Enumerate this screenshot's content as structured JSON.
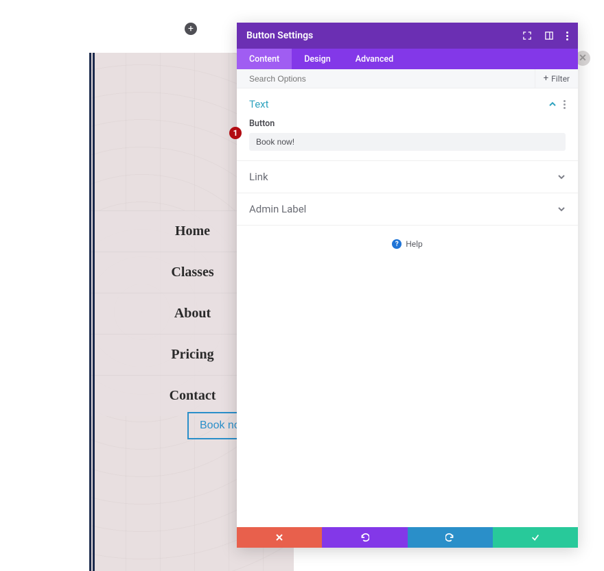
{
  "preview": {
    "nav_items": [
      "Home",
      "Classes",
      "About",
      "Pricing",
      "Contact"
    ],
    "button_label": "Book now!",
    "add_label": "+",
    "close_label": "✕"
  },
  "panel": {
    "title": "Button Settings",
    "tabs": {
      "content": "Content",
      "design": "Design",
      "advanced": "Advanced"
    },
    "search_placeholder": "Search Options",
    "filter_label": "Filter",
    "sections": {
      "text": {
        "title": "Text",
        "field_label": "Button",
        "field_value": "Book now!"
      },
      "link": {
        "title": "Link"
      },
      "admin": {
        "title": "Admin Label"
      }
    },
    "help_label": "Help",
    "badge": "1"
  }
}
